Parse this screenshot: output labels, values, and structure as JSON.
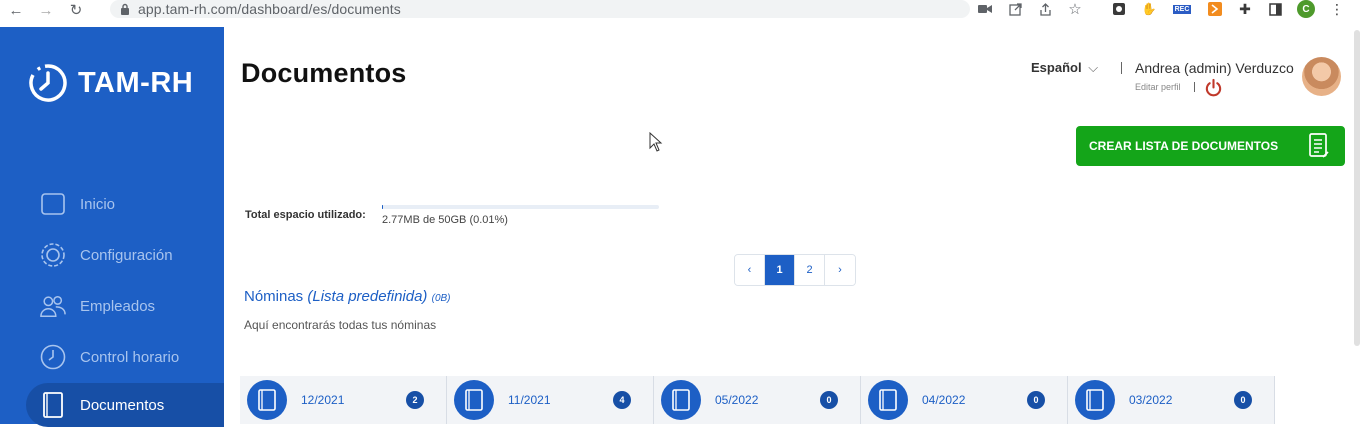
{
  "browser": {
    "url": "app.tam-rh.com/dashboard/es/documents",
    "rec_label": "REC",
    "profile_initial": "C"
  },
  "sidebar": {
    "logo_text": "TAM-RH",
    "items": [
      {
        "label": "Inicio",
        "icon": "home-square-icon"
      },
      {
        "label": "Configuración",
        "icon": "gear-icon"
      },
      {
        "label": "Empleados",
        "icon": "users-icon"
      },
      {
        "label": "Control horario",
        "icon": "clock-icon"
      },
      {
        "label": "Documentos",
        "icon": "document-icon",
        "active": true
      }
    ]
  },
  "header": {
    "title": "Documentos",
    "language": "Español",
    "user_name": "Andrea (admin) Verduzco",
    "edit_profile": "Editar perfil"
  },
  "actions": {
    "create_list_label": "CREAR LISTA DE DOCUMENTOS"
  },
  "storage": {
    "label": "Total espacio utilizado:",
    "value": "2.77MB de 50GB (0.01%)",
    "used_fraction": 0.0001
  },
  "pagination": {
    "prev": "‹",
    "pages": [
      "1",
      "2"
    ],
    "current": "1",
    "next": "›"
  },
  "section": {
    "title": "Nóminas",
    "subtitle": "(Lista predefinida)",
    "size": "(0B)",
    "description": "Aquí encontrarás todas tus nóminas"
  },
  "folders": [
    {
      "label": "12/2021",
      "count": "2"
    },
    {
      "label": "11/2021",
      "count": "4"
    },
    {
      "label": "05/2022",
      "count": "0"
    },
    {
      "label": "04/2022",
      "count": "0"
    },
    {
      "label": "03/2022",
      "count": "0"
    }
  ],
  "colors": {
    "brand_blue": "#1d5fc5",
    "sidebar_active": "#174fa6",
    "create_green": "#14a519",
    "power_red": "#c0392b"
  }
}
